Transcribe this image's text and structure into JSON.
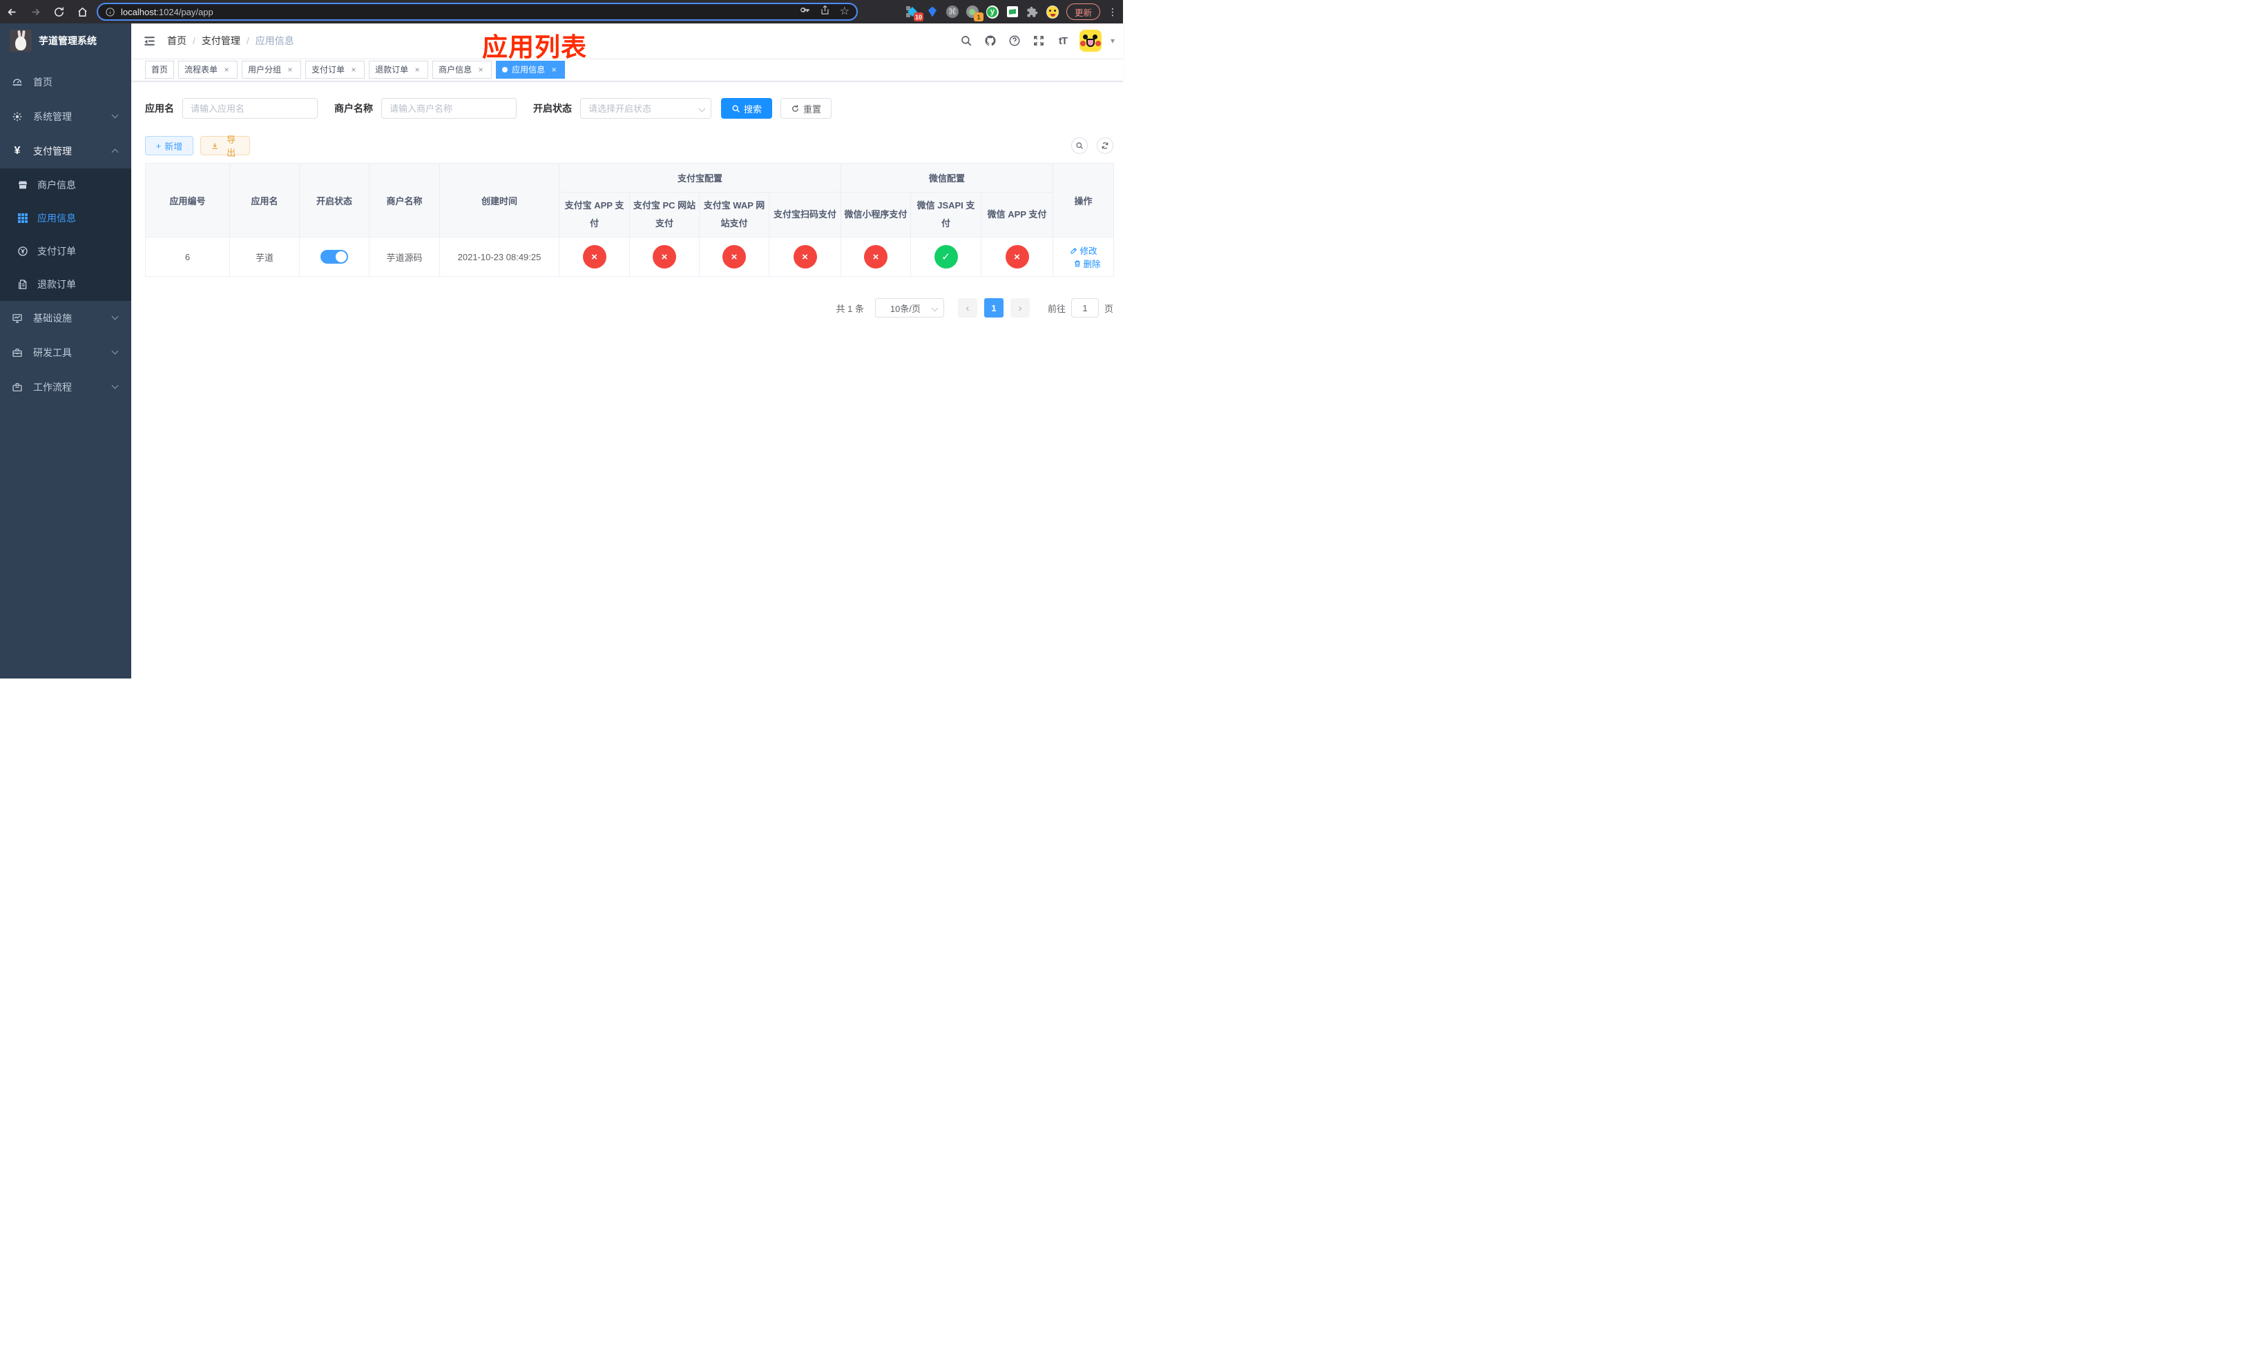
{
  "browser": {
    "url_host": "localhost",
    "url_path": ":1024/pay/app",
    "update_label": "更新",
    "ext_diamond_badge": "10",
    "ext_circle_badge": "1",
    "ext_letter": "y"
  },
  "icons": {
    "close": "×",
    "check": "✓",
    "cross": "×",
    "plus": "+",
    "dots": "⋮",
    "command": "⌘",
    "star": "☆",
    "caret": "▾",
    "slash": "/",
    "font_size": "tT",
    "yen": "¥",
    "prev": "‹",
    "next": "›"
  },
  "sidebar": {
    "title": "芋道管理系统",
    "menu_home": "首页",
    "menu_system": "系统管理",
    "menu_pay": "支付管理",
    "menu_infra": "基础设施",
    "menu_dev": "研发工具",
    "menu_flow": "工作流程",
    "sub_merchant": "商户信息",
    "sub_app": "应用信息",
    "sub_order": "支付订单",
    "sub_refund": "退款订单"
  },
  "header": {
    "breadcrumb": [
      "首页",
      "支付管理",
      "应用信息"
    ],
    "annotation": "应用列表"
  },
  "tabs": [
    {
      "label": "首页"
    },
    {
      "label": "流程表单"
    },
    {
      "label": "用户分组"
    },
    {
      "label": "支付订单"
    },
    {
      "label": "退款订单"
    },
    {
      "label": "商户信息"
    },
    {
      "label": "应用信息"
    }
  ],
  "filters": {
    "app_name_label": "应用名",
    "app_name_placeholder": "请输入应用名",
    "merchant_label": "商户名称",
    "merchant_placeholder": "请输入商户名称",
    "status_label": "开启状态",
    "status_placeholder": "请选择开启状态",
    "search_label": "搜索",
    "reset_label": "重置"
  },
  "toolbar": {
    "add_label": "新增",
    "export_label": "导出"
  },
  "table": {
    "columns": {
      "id": "应用编号",
      "name": "应用名",
      "enabled": "开启状态",
      "merchant": "商户名称",
      "created": "创建时间",
      "op": "操作"
    },
    "groups": {
      "alipay": "支付宝配置",
      "wechat": "微信配置"
    },
    "sub_columns": [
      "支付宝 APP 支付",
      "支付宝 PC 网站支付",
      "支付宝 WAP 网站支付",
      "支付宝扫码支付",
      "微信小程序支付",
      "微信 JSAPI 支付",
      "微信 APP 支付"
    ],
    "rows": [
      {
        "id": "6",
        "name": "芋道",
        "enabled": true,
        "merchant": "芋道源码",
        "created": "2021-10-23 08:49:25",
        "statuses": [
          false,
          false,
          false,
          false,
          false,
          true,
          false
        ],
        "edit_label": "修改",
        "delete_label": "删除"
      }
    ]
  },
  "pagination": {
    "total": "共 1 条",
    "page_size": "10条/页",
    "page": "1",
    "goto_label": "前往",
    "goto_value": "1",
    "unit_label": "页"
  },
  "colors": {
    "primary": "#409eff",
    "search_blue": "#1890ff",
    "success": "#13ce66",
    "danger": "#f3453e",
    "warning": "#e6a23c",
    "sidebar_bg": "#304156",
    "submenu_bg": "#1f2d3d",
    "annotation_red": "#ff2b00"
  }
}
